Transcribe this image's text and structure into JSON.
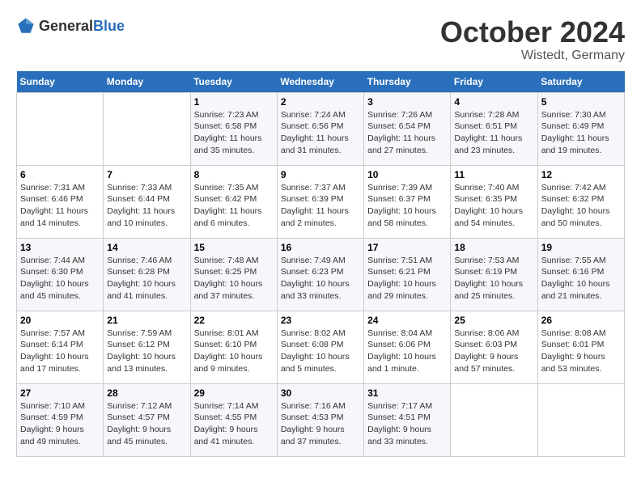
{
  "logo": {
    "general": "General",
    "blue": "Blue"
  },
  "title": {
    "month": "October 2024",
    "location": "Wistedt, Germany"
  },
  "weekdays": [
    "Sunday",
    "Monday",
    "Tuesday",
    "Wednesday",
    "Thursday",
    "Friday",
    "Saturday"
  ],
  "weeks": [
    [
      {
        "day": "",
        "info": ""
      },
      {
        "day": "",
        "info": ""
      },
      {
        "day": "1",
        "info": "Sunrise: 7:23 AM\nSunset: 6:58 PM\nDaylight: 11 hours and 35 minutes."
      },
      {
        "day": "2",
        "info": "Sunrise: 7:24 AM\nSunset: 6:56 PM\nDaylight: 11 hours and 31 minutes."
      },
      {
        "day": "3",
        "info": "Sunrise: 7:26 AM\nSunset: 6:54 PM\nDaylight: 11 hours and 27 minutes."
      },
      {
        "day": "4",
        "info": "Sunrise: 7:28 AM\nSunset: 6:51 PM\nDaylight: 11 hours and 23 minutes."
      },
      {
        "day": "5",
        "info": "Sunrise: 7:30 AM\nSunset: 6:49 PM\nDaylight: 11 hours and 19 minutes."
      }
    ],
    [
      {
        "day": "6",
        "info": "Sunrise: 7:31 AM\nSunset: 6:46 PM\nDaylight: 11 hours and 14 minutes."
      },
      {
        "day": "7",
        "info": "Sunrise: 7:33 AM\nSunset: 6:44 PM\nDaylight: 11 hours and 10 minutes."
      },
      {
        "day": "8",
        "info": "Sunrise: 7:35 AM\nSunset: 6:42 PM\nDaylight: 11 hours and 6 minutes."
      },
      {
        "day": "9",
        "info": "Sunrise: 7:37 AM\nSunset: 6:39 PM\nDaylight: 11 hours and 2 minutes."
      },
      {
        "day": "10",
        "info": "Sunrise: 7:39 AM\nSunset: 6:37 PM\nDaylight: 10 hours and 58 minutes."
      },
      {
        "day": "11",
        "info": "Sunrise: 7:40 AM\nSunset: 6:35 PM\nDaylight: 10 hours and 54 minutes."
      },
      {
        "day": "12",
        "info": "Sunrise: 7:42 AM\nSunset: 6:32 PM\nDaylight: 10 hours and 50 minutes."
      }
    ],
    [
      {
        "day": "13",
        "info": "Sunrise: 7:44 AM\nSunset: 6:30 PM\nDaylight: 10 hours and 45 minutes."
      },
      {
        "day": "14",
        "info": "Sunrise: 7:46 AM\nSunset: 6:28 PM\nDaylight: 10 hours and 41 minutes."
      },
      {
        "day": "15",
        "info": "Sunrise: 7:48 AM\nSunset: 6:25 PM\nDaylight: 10 hours and 37 minutes."
      },
      {
        "day": "16",
        "info": "Sunrise: 7:49 AM\nSunset: 6:23 PM\nDaylight: 10 hours and 33 minutes."
      },
      {
        "day": "17",
        "info": "Sunrise: 7:51 AM\nSunset: 6:21 PM\nDaylight: 10 hours and 29 minutes."
      },
      {
        "day": "18",
        "info": "Sunrise: 7:53 AM\nSunset: 6:19 PM\nDaylight: 10 hours and 25 minutes."
      },
      {
        "day": "19",
        "info": "Sunrise: 7:55 AM\nSunset: 6:16 PM\nDaylight: 10 hours and 21 minutes."
      }
    ],
    [
      {
        "day": "20",
        "info": "Sunrise: 7:57 AM\nSunset: 6:14 PM\nDaylight: 10 hours and 17 minutes."
      },
      {
        "day": "21",
        "info": "Sunrise: 7:59 AM\nSunset: 6:12 PM\nDaylight: 10 hours and 13 minutes."
      },
      {
        "day": "22",
        "info": "Sunrise: 8:01 AM\nSunset: 6:10 PM\nDaylight: 10 hours and 9 minutes."
      },
      {
        "day": "23",
        "info": "Sunrise: 8:02 AM\nSunset: 6:08 PM\nDaylight: 10 hours and 5 minutes."
      },
      {
        "day": "24",
        "info": "Sunrise: 8:04 AM\nSunset: 6:06 PM\nDaylight: 10 hours and 1 minute."
      },
      {
        "day": "25",
        "info": "Sunrise: 8:06 AM\nSunset: 6:03 PM\nDaylight: 9 hours and 57 minutes."
      },
      {
        "day": "26",
        "info": "Sunrise: 8:08 AM\nSunset: 6:01 PM\nDaylight: 9 hours and 53 minutes."
      }
    ],
    [
      {
        "day": "27",
        "info": "Sunrise: 7:10 AM\nSunset: 4:59 PM\nDaylight: 9 hours and 49 minutes."
      },
      {
        "day": "28",
        "info": "Sunrise: 7:12 AM\nSunset: 4:57 PM\nDaylight: 9 hours and 45 minutes."
      },
      {
        "day": "29",
        "info": "Sunrise: 7:14 AM\nSunset: 4:55 PM\nDaylight: 9 hours and 41 minutes."
      },
      {
        "day": "30",
        "info": "Sunrise: 7:16 AM\nSunset: 4:53 PM\nDaylight: 9 hours and 37 minutes."
      },
      {
        "day": "31",
        "info": "Sunrise: 7:17 AM\nSunset: 4:51 PM\nDaylight: 9 hours and 33 minutes."
      },
      {
        "day": "",
        "info": ""
      },
      {
        "day": "",
        "info": ""
      }
    ]
  ]
}
